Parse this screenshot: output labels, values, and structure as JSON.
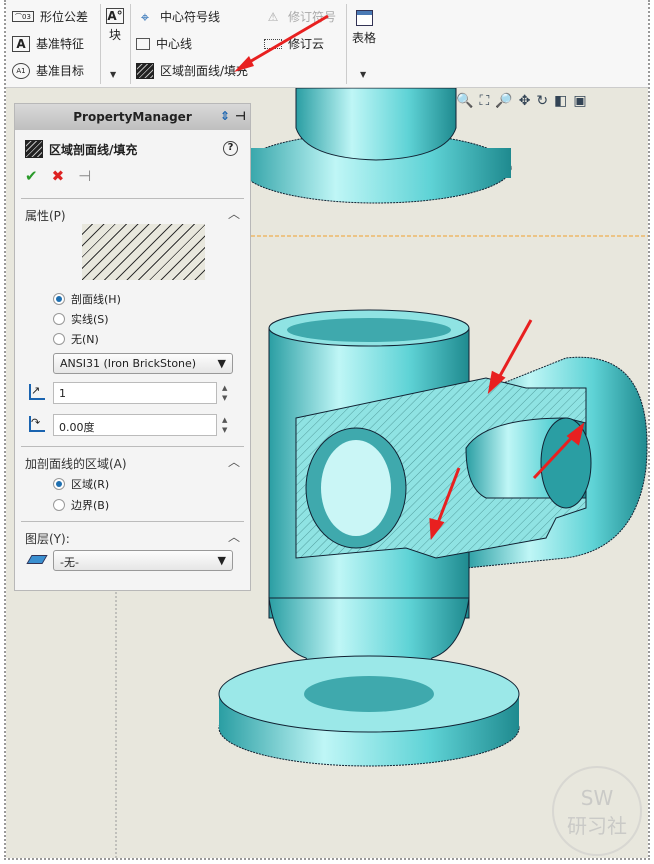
{
  "toolbar": {
    "geo_tol": "形位公差",
    "datum_feature": "基准特征",
    "datum_target": "基准目标",
    "block": "块",
    "center_mark": "中心符号线",
    "centerline": "中心线",
    "area_hatch": "区域剖面线/填充",
    "revision_symbol": "修订符号",
    "revision_cloud": "修订云",
    "table": "表格"
  },
  "pm": {
    "header": "PropertyManager",
    "title": "区域剖面线/填充",
    "props_section": "属性(P)",
    "fill_options": [
      {
        "label": "剖面线(H)",
        "selected": true
      },
      {
        "label": "实线(S)",
        "selected": false
      },
      {
        "label": "无(N)",
        "selected": false
      }
    ],
    "pattern": "ANSI31 (Iron BrickStone)",
    "scale": "1",
    "angle": "0.00度",
    "area_section": "加剖面线的区域(A)",
    "area_options": [
      {
        "label": "区域(R)",
        "selected": true
      },
      {
        "label": "边界(B)",
        "selected": false
      }
    ],
    "layer_section": "图层(Y):",
    "layer": "-无-"
  },
  "watermark": {
    "line1": "SW",
    "line2": "研习社"
  },
  "colors": {
    "part": "#5fd3d6",
    "arrow": "#e82020",
    "sketch_line": "#f0a030"
  }
}
